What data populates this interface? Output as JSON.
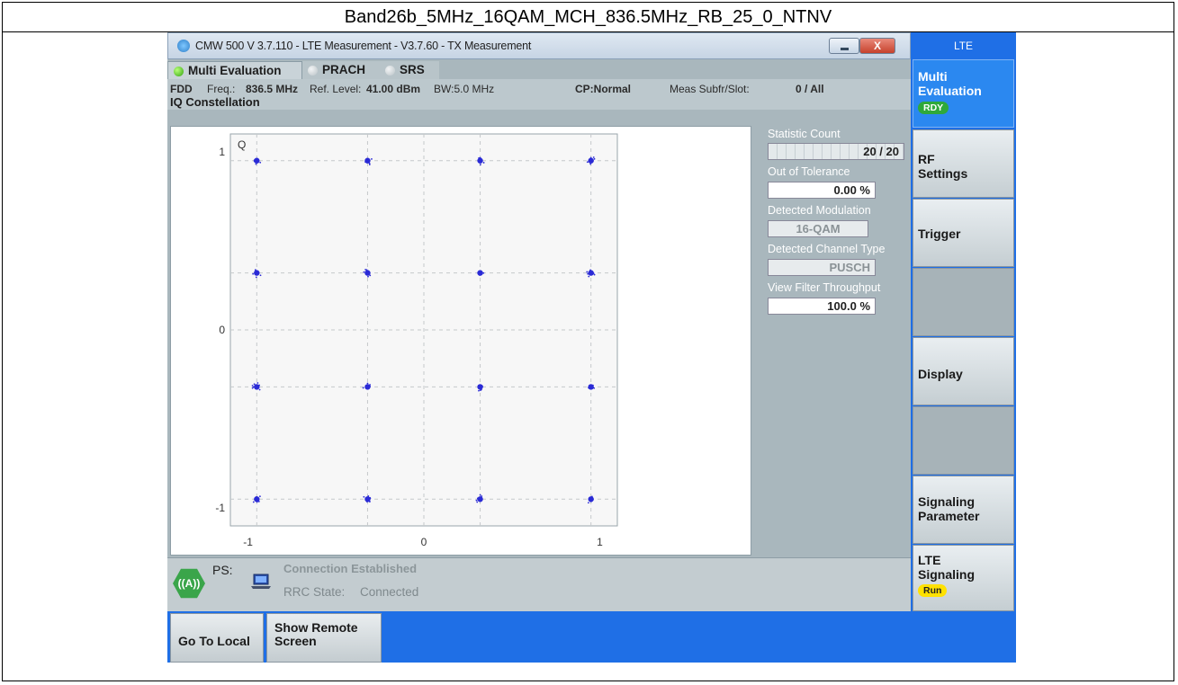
{
  "caption": "Band26b_5MHz_16QAM_MCH_836.5MHz_RB_25_0_NTNV",
  "window": {
    "title": "CMW 500 V 3.7.110 - LTE Measurement - V3.7.60 - TX Measurement",
    "close_glyph": "X"
  },
  "tabs": [
    "Multi Evaluation",
    "PRACH",
    "SRS"
  ],
  "info": {
    "mode": "FDD",
    "freq_label": "Freq.:",
    "freq_value": "836.5 MHz",
    "ref_label": "Ref. Level:",
    "ref_value": "41.00 dBm",
    "bw": "BW:5.0 MHz",
    "cp": "CP:Normal",
    "meas_label": "Meas Subfr/Slot:",
    "meas_value": "0 / All"
  },
  "plot": {
    "heading": "IQ Constellation",
    "q_axis_label": "Q",
    "y_ticks": [
      "1",
      "0",
      "-1"
    ],
    "x_ticks": [
      "-1",
      "0",
      "1"
    ],
    "point_color": "#2b2bd6"
  },
  "chart_data": {
    "type": "scatter",
    "title": "IQ Constellation",
    "ylabel": "Q",
    "xlim": [
      -1.1,
      1.1
    ],
    "ylim": [
      -1.1,
      1.1
    ],
    "grid": true,
    "constellation_points": [
      [
        -0.95,
        0.95
      ],
      [
        -0.32,
        0.95
      ],
      [
        0.32,
        0.95
      ],
      [
        0.95,
        0.95
      ],
      [
        -0.95,
        0.32
      ],
      [
        -0.32,
        0.32
      ],
      [
        0.32,
        0.32
      ],
      [
        0.95,
        0.32
      ],
      [
        -0.95,
        -0.32
      ],
      [
        -0.32,
        -0.32
      ],
      [
        0.32,
        -0.32
      ],
      [
        0.95,
        -0.32
      ],
      [
        -0.95,
        -0.95
      ],
      [
        -0.32,
        -0.95
      ],
      [
        0.32,
        -0.95
      ],
      [
        0.95,
        -0.95
      ]
    ]
  },
  "stats": {
    "statistic_count_label": "Statistic Count",
    "statistic_count_value": "20 / 20",
    "statistic_count_fill": 1.0,
    "out_of_tolerance_label": "Out of Tolerance",
    "out_of_tolerance_value": "0.00 %",
    "detected_modulation_label": "Detected Modulation",
    "detected_modulation_value": "16-QAM",
    "detected_channel_label": "Detected Channel Type",
    "detected_channel_value": "PUSCH",
    "view_filter_label": "View Filter Throughput",
    "view_filter_value": "100.0 %"
  },
  "connection": {
    "ps_label": "PS:",
    "status": "Connection Established",
    "rrc_label": "RRC State:",
    "rrc_value": "Connected",
    "antenna_icon": "antenna-icon",
    "laptop_icon": "laptop-icon"
  },
  "softkeys": {
    "header": "LTE",
    "multi_evaluation_line1": "Multi",
    "multi_evaluation_line2": "Evaluation",
    "multi_evaluation_badge": "RDY",
    "rf_settings_line1": "RF",
    "rf_settings_line2": "Settings",
    "trigger": "Trigger",
    "display": "Display",
    "signaling_parameter_line1": "Signaling",
    "signaling_parameter_line2": "Parameter",
    "lte_signaling_line1": "LTE",
    "lte_signaling_line2": "Signaling",
    "lte_signaling_badge": "Run"
  },
  "bottom": {
    "go_to_local": "Go To Local",
    "show_remote_line1": "Show Remote",
    "show_remote_line2": "Screen"
  },
  "colors": {
    "accent_blue": "#1f6fe6",
    "panel_gray": "#a9b7bd",
    "rdy_green": "#2fa93a",
    "run_yellow": "#ffe100"
  }
}
